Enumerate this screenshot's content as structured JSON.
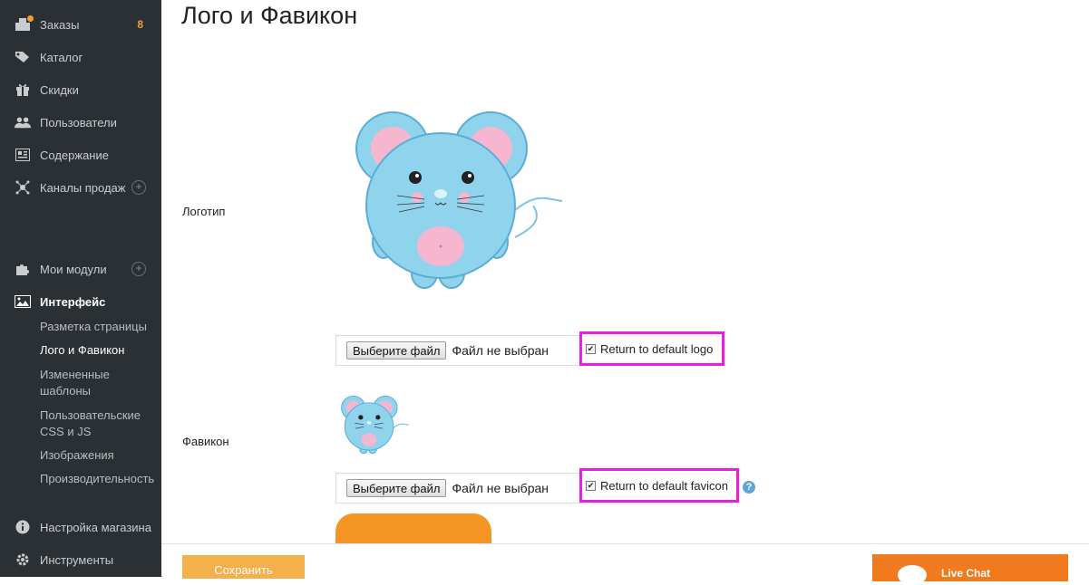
{
  "sidebar": {
    "orders": {
      "label": "Заказы",
      "count": "8"
    },
    "catalog": "Каталог",
    "discounts": "Скидки",
    "users": "Пользователи",
    "content": "Содержание",
    "channels": "Каналы продаж",
    "modules": "Мои модули",
    "interface": "Интерфейс",
    "sub": {
      "layout": "Разметка страницы",
      "logo": "Лого и Фавикон",
      "templates": "Измененные шаблоны",
      "css": "Пользовательские CSS и JS",
      "images": "Изображения",
      "performance": "Производительность"
    },
    "store_settings": "Настройка магазина",
    "tools": "Инструменты"
  },
  "main": {
    "title": "Лого и Фавикон",
    "logo_label": "Логотип",
    "favicon_label": "Фавикон",
    "file_button": "Выберите файл",
    "file_status": "Файл не выбран",
    "return_logo": "Return to default logo",
    "return_favicon": "Return to default favicon",
    "help": "?"
  },
  "footer": {
    "save": "Сохранить",
    "live_chat": "Live Chat"
  },
  "colors": {
    "sidebar_bg": "#2b3034",
    "accent": "#f39623",
    "highlight": "#e81ee0"
  }
}
